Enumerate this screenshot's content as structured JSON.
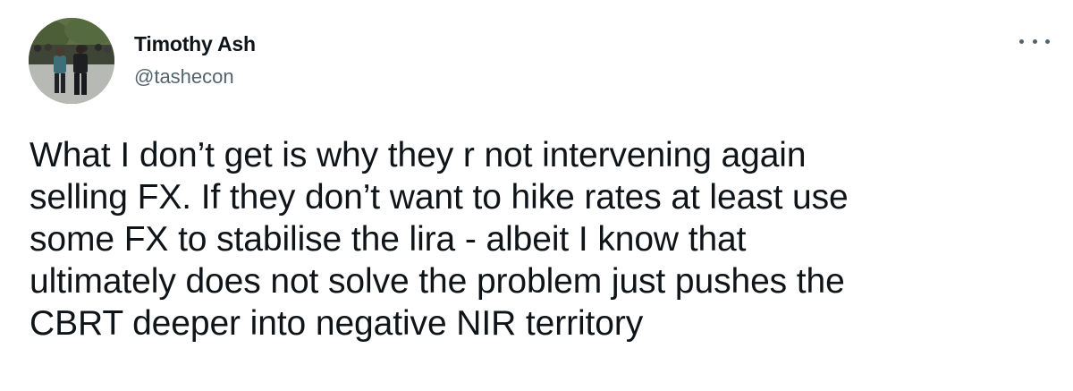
{
  "author": {
    "display_name": "Timothy Ash",
    "handle": "@tashecon"
  },
  "menu": {
    "icon": "more-horizontal-icon"
  },
  "tweet": {
    "lines": [
      "What I don’t get is why they r not intervening again",
      "selling FX. If they don’t want to hike rates at least use",
      "some FX to stabilise the lira - albeit I know that",
      "ultimately does not solve the problem just pushes the",
      "CBRT deeper into negative NIR territory"
    ]
  },
  "colors": {
    "text_primary": "#0f1419",
    "text_secondary": "#536471",
    "background": "#ffffff"
  }
}
